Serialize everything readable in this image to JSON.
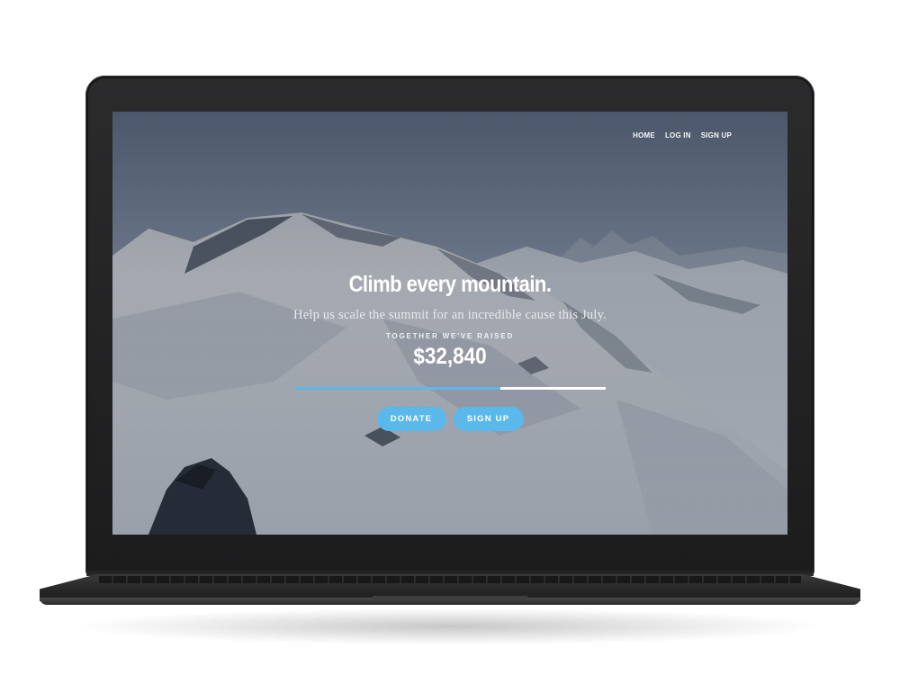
{
  "nav": {
    "home": "HOME",
    "login": "LOG IN",
    "signup": "SIGN UP"
  },
  "hero": {
    "headline": "Climb every mountain.",
    "subline": "Help us scale the summit for an incredible cause this July.",
    "raised_label": "TOGETHER WE'VE RAISED",
    "amount": "$32,840",
    "progress_fraction": 0.66
  },
  "buttons": {
    "donate": "DONATE",
    "signup": "SIGN UP"
  },
  "colors": {
    "accent": "#5ab8ea",
    "overlay": "#1e2634"
  }
}
